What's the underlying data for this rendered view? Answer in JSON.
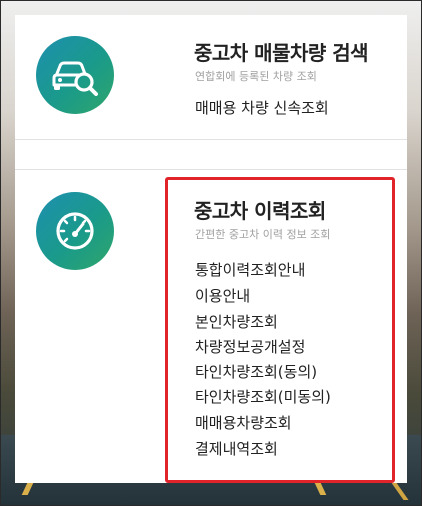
{
  "section1": {
    "title": "중고차 매물차량 검색",
    "subtitle": "연합회에 등록된 차량 조회",
    "links": [
      "매매용 차량 신속조회"
    ]
  },
  "section2": {
    "title": "중고차 이력조회",
    "subtitle": "간편한 중고차 이력 정보 조회",
    "links": [
      "통합이력조회안내",
      "이용안내",
      "본인차량조회",
      "차량정보공개설정",
      "타인차량조회(동의)",
      "타인차량조회(미동의)",
      "매매용차량조회",
      "결제내역조회"
    ]
  },
  "colors": {
    "accent_gradient_start": "#1e8fb0",
    "accent_gradient_end": "#2fa66a",
    "highlight_border": "#e0242a"
  },
  "icons": {
    "section1": "car-search-icon",
    "section2": "speedometer-icon"
  }
}
